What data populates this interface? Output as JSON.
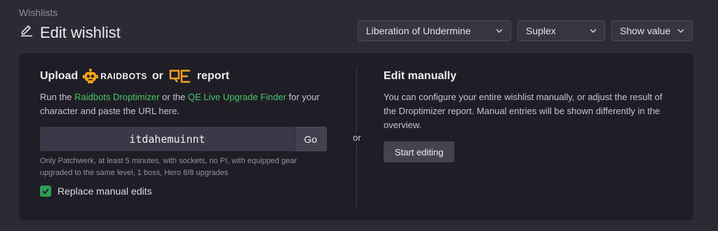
{
  "breadcrumb": "Wishlists",
  "page_title": "Edit wishlist",
  "selects": {
    "raid": "Liberation of Undermine",
    "boss": "Suplex",
    "show": "Show value"
  },
  "upload": {
    "heading_prefix": "Upload",
    "raidbots_logo_text": "RAIDBOTS",
    "heading_or": "or",
    "heading_suffix": "report",
    "desc_part1": "Run the ",
    "link_droptimizer": "Raidbots Droptimizer",
    "desc_part2": " or the ",
    "link_qe": "QE Live Upgrade Finder",
    "desc_part3": " for your character and paste the URL here.",
    "url_value": "itdahemuinnt",
    "go_label": "Go",
    "hint": "Only Patchwerk, at least 5 minutes, with sockets, no PI, with equipped gear upgraded to the same level, 1 boss, Hero 8/8 upgrades",
    "checkbox_label": "Replace manual edits",
    "checkbox_checked": true
  },
  "or_label": "or",
  "manual": {
    "heading": "Edit manually",
    "desc": "You can configure your entire wishlist manually, or adjust the result of the Droptimizer report. Manual entries will be shown differently in the overview.",
    "button_label": "Start editing"
  },
  "colors": {
    "accent_green": "#48c766",
    "checkbox_green": "#2f9e55",
    "raidbots_orange": "#f2a31b",
    "background": "#2c2b35",
    "panel": "#1f1e27"
  }
}
